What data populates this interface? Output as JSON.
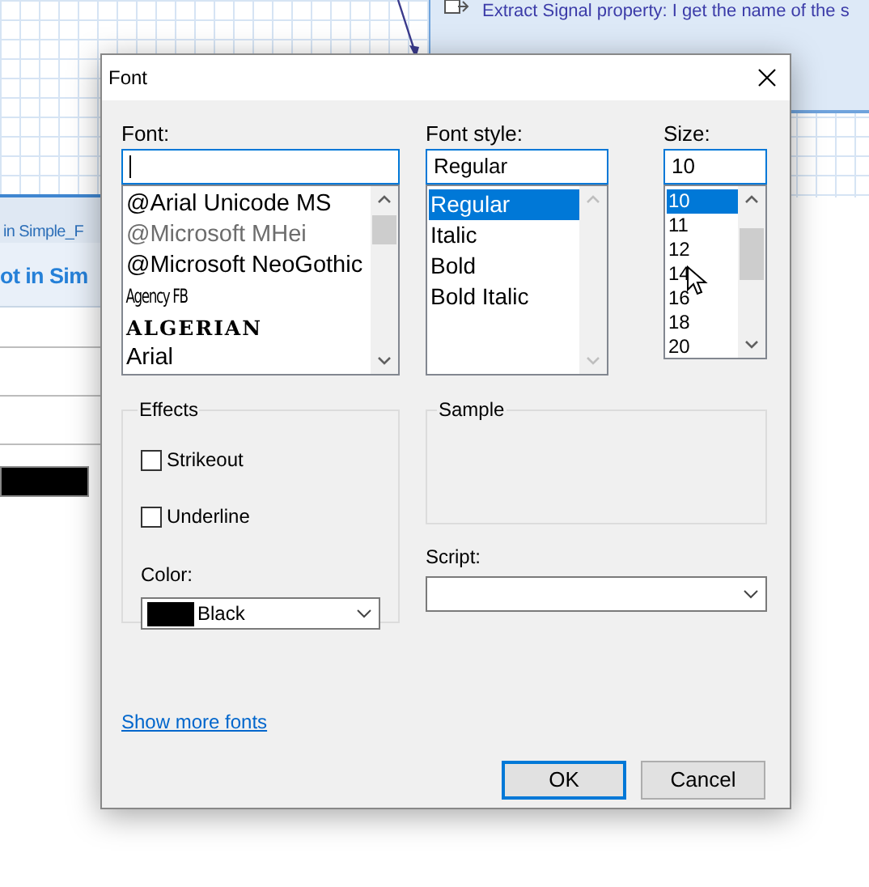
{
  "background": {
    "panel_title": "Extract Signal property: I get the name of the s",
    "tab_label": "in Simple_F",
    "heading": "ot in Sim"
  },
  "dialog": {
    "title": "Font",
    "font": {
      "label": "Font:",
      "items": [
        {
          "label": "@Arial Unicode MS",
          "kind": "normal",
          "selected": false
        },
        {
          "label": "@Microsoft MHei",
          "kind": "dimmed",
          "selected": false
        },
        {
          "label": "@Microsoft NeoGothic",
          "kind": "normal",
          "selected": false
        },
        {
          "label": "Agency FB",
          "kind": "condensed",
          "selected": false
        },
        {
          "label": "ALGERIAN",
          "kind": "decorative",
          "selected": false
        },
        {
          "label": "Arial",
          "kind": "normal",
          "selected": false
        }
      ]
    },
    "style": {
      "label": "Font style:",
      "value": "Regular",
      "items": [
        {
          "label": "Regular",
          "selected": true
        },
        {
          "label": "Italic",
          "selected": false
        },
        {
          "label": "Bold",
          "selected": false
        },
        {
          "label": "Bold Italic",
          "selected": false
        }
      ]
    },
    "size": {
      "label": "Size:",
      "value": "10",
      "items": [
        {
          "label": "10",
          "selected": true
        },
        {
          "label": "11",
          "selected": false
        },
        {
          "label": "12",
          "selected": false
        },
        {
          "label": "14",
          "selected": false
        },
        {
          "label": "16",
          "selected": false
        },
        {
          "label": "18",
          "selected": false
        },
        {
          "label": "20",
          "selected": false
        }
      ]
    },
    "effects": {
      "title": "Effects",
      "options": [
        {
          "label": "Strikeout",
          "checked": false
        },
        {
          "label": "Underline",
          "checked": false
        }
      ],
      "color_label": "Color:",
      "color": {
        "label": "Black",
        "color": "#000000"
      }
    },
    "sample": {
      "title": "Sample"
    },
    "script": {
      "label": "Script:"
    },
    "link": "Show more fonts",
    "buttons": [
      {
        "label": "OK",
        "default": true
      },
      {
        "label": "Cancel",
        "default": false
      }
    ]
  }
}
